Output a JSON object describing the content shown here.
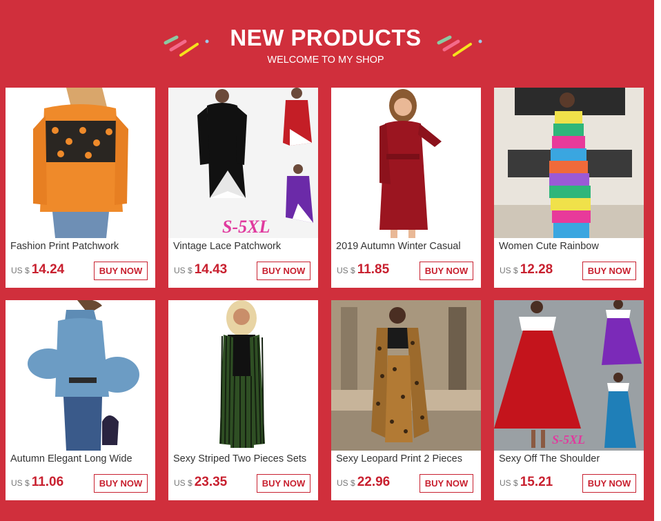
{
  "header": {
    "title": "NEW PRODUCTS",
    "subtitle": "WELCOME TO MY SHOP"
  },
  "colors": {
    "background": "#d02f3c",
    "accent": "#c8202f",
    "deco_green": "#8bc9a2",
    "deco_pink": "#f46a8a",
    "deco_yellow": "#f6e21c"
  },
  "products": [
    {
      "title": "Fashion Print Patchwork",
      "currency": "US $",
      "price": "14.24",
      "button": "BUY NOW"
    },
    {
      "title": "Vintage Lace Patchwork",
      "currency": "US $",
      "price": "14.43",
      "button": "BUY NOW",
      "badge": "S-5XL"
    },
    {
      "title": "2019 Autumn Winter Casual",
      "currency": "US $",
      "price": "11.85",
      "button": "BUY NOW"
    },
    {
      "title": "Women Cute Rainbow",
      "currency": "US $",
      "price": "12.28",
      "button": "BUY NOW"
    },
    {
      "title": "Autumn Elegant Long Wide",
      "currency": "US $",
      "price": "11.06",
      "button": "BUY NOW"
    },
    {
      "title": "Sexy Striped Two Pieces Sets",
      "currency": "US $",
      "price": "23.35",
      "button": "BUY NOW"
    },
    {
      "title": "Sexy Leopard Print 2 Pieces",
      "currency": "US $",
      "price": "22.96",
      "button": "BUY NOW"
    },
    {
      "title": "Sexy Off The Shoulder",
      "currency": "US $",
      "price": "15.21",
      "button": "BUY NOW",
      "badge": "S-5XL"
    }
  ]
}
